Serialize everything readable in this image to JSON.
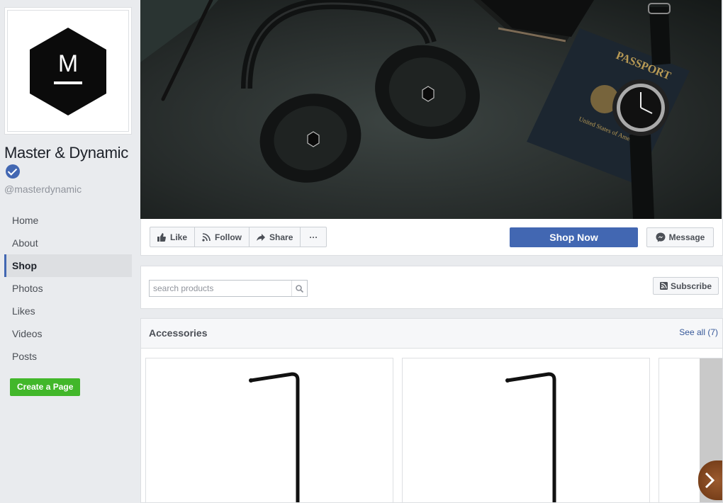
{
  "page": {
    "name": "Master & Dynamic",
    "handle": "@masterdynamic",
    "verified": true,
    "logo_letter": "M"
  },
  "nav": {
    "items": [
      "Home",
      "About",
      "Shop",
      "Photos",
      "Likes",
      "Videos",
      "Posts"
    ],
    "active": "Shop"
  },
  "create_page_label": "Create a Page",
  "actions": {
    "like": "Like",
    "follow": "Follow",
    "share": "Share",
    "more": "···",
    "shop_now": "Shop Now",
    "message": "Message"
  },
  "search": {
    "placeholder": "search products",
    "value": ""
  },
  "subscribe_label": "Subscribe",
  "accessories": {
    "title": "Accessories",
    "see_all": "See all (7)"
  },
  "cover": {
    "passport_text": "PASSPORT",
    "passport_country": "United States of America"
  },
  "colors": {
    "brand_blue": "#4267b2",
    "create_green": "#42b72a",
    "sidebar_bg": "#e9ebee"
  }
}
